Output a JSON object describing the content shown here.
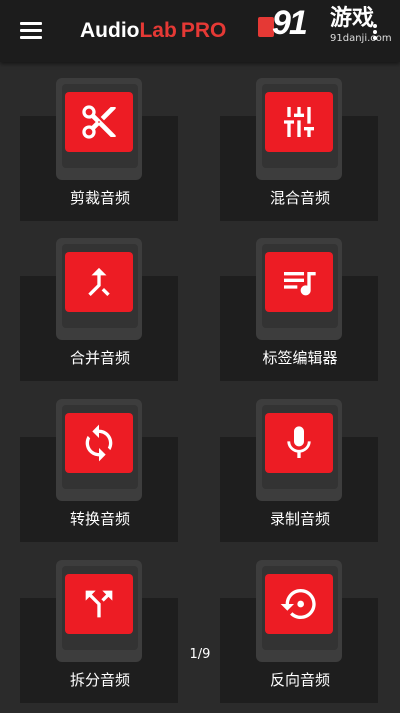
{
  "topbar": {
    "title_part1": "Audio",
    "title_part2": "Lab",
    "title_part3": "PRO",
    "accent_color": "#e53935"
  },
  "watermark": {
    "number": "91",
    "chinese": "游戏",
    "url": "91danji.com"
  },
  "tiles": [
    {
      "label": "剪裁音频",
      "icon": "scissors-icon"
    },
    {
      "label": "混合音频",
      "icon": "equalizer-icon"
    },
    {
      "label": "合并音频",
      "icon": "merge-icon"
    },
    {
      "label": "标签编辑器",
      "icon": "playlist-music-icon"
    },
    {
      "label": "转换音频",
      "icon": "sync-icon"
    },
    {
      "label": "录制音频",
      "icon": "microphone-icon"
    },
    {
      "label": "拆分音频",
      "icon": "split-arrows-icon"
    },
    {
      "label": "反向音频",
      "icon": "reverse-icon"
    }
  ],
  "pager": {
    "text": "1/9"
  },
  "colors": {
    "background": "#2b2b2b",
    "topbar": "#1c1c1c",
    "icon_red": "#ed1c24"
  }
}
